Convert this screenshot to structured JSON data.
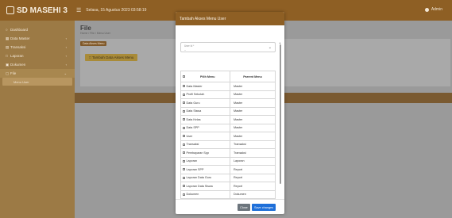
{
  "app": {
    "brand": "SD MASEHI 3",
    "datetime": "Selasa, 15 Agustus 2023 03:58:19",
    "user_label": "Admin"
  },
  "sidebar": {
    "items": [
      {
        "label": "Dashboard",
        "icon": "gauge-icon"
      },
      {
        "label": "Data Master",
        "icon": "table-icon"
      },
      {
        "label": "Transaksi",
        "icon": "receipt-icon"
      },
      {
        "label": "Laporan",
        "icon": "report-icon"
      },
      {
        "label": "Dokumen",
        "icon": "document-icon"
      },
      {
        "label": "File",
        "icon": "folder-icon"
      }
    ],
    "sub_item": "Menu User"
  },
  "page": {
    "title": "File",
    "breadcrumb": "Home / File / Menu User",
    "card_tag": "Data Akses Menu",
    "add_button": "Tambah Data Akses Menu",
    "footer": "All Rights Reserved"
  },
  "modal": {
    "title": "Tambah Akses Menu User",
    "select": {
      "label": "User Id *",
      "value": "--"
    },
    "table": {
      "headers": [
        "Pilih Menu",
        "Parrent Menu"
      ],
      "rows": [
        [
          "Data Master",
          "Master"
        ],
        [
          "Profil Sekolah",
          "Master"
        ],
        [
          "Data Guru",
          "Master"
        ],
        [
          "Data Siswa",
          "Master"
        ],
        [
          "Data Kelas",
          "Master"
        ],
        [
          "Data SPP",
          "Master"
        ],
        [
          "User",
          "Master"
        ],
        [
          "Transaksi",
          "Transaksi"
        ],
        [
          "Pembayaran Spp",
          "Transaksi"
        ],
        [
          "Laporan",
          "Laporan"
        ],
        [
          "Laporan SPP",
          "Report"
        ],
        [
          "Laporan Data Guru",
          "Report"
        ],
        [
          "Laporan Data Siswa",
          "Report"
        ],
        [
          "Dokumen",
          "Dokumen"
        ],
        [
          "About",
          "Dokumen"
        ],
        [
          "Galeri",
          "Dokumen"
        ]
      ]
    },
    "close_label": "Close",
    "save_label": "Save changes"
  },
  "colors": {
    "brand": "#8e5f24",
    "sidebar": "#9c7a45",
    "primary_button": "#1e6fd9",
    "secondary_button": "#6c757d"
  }
}
